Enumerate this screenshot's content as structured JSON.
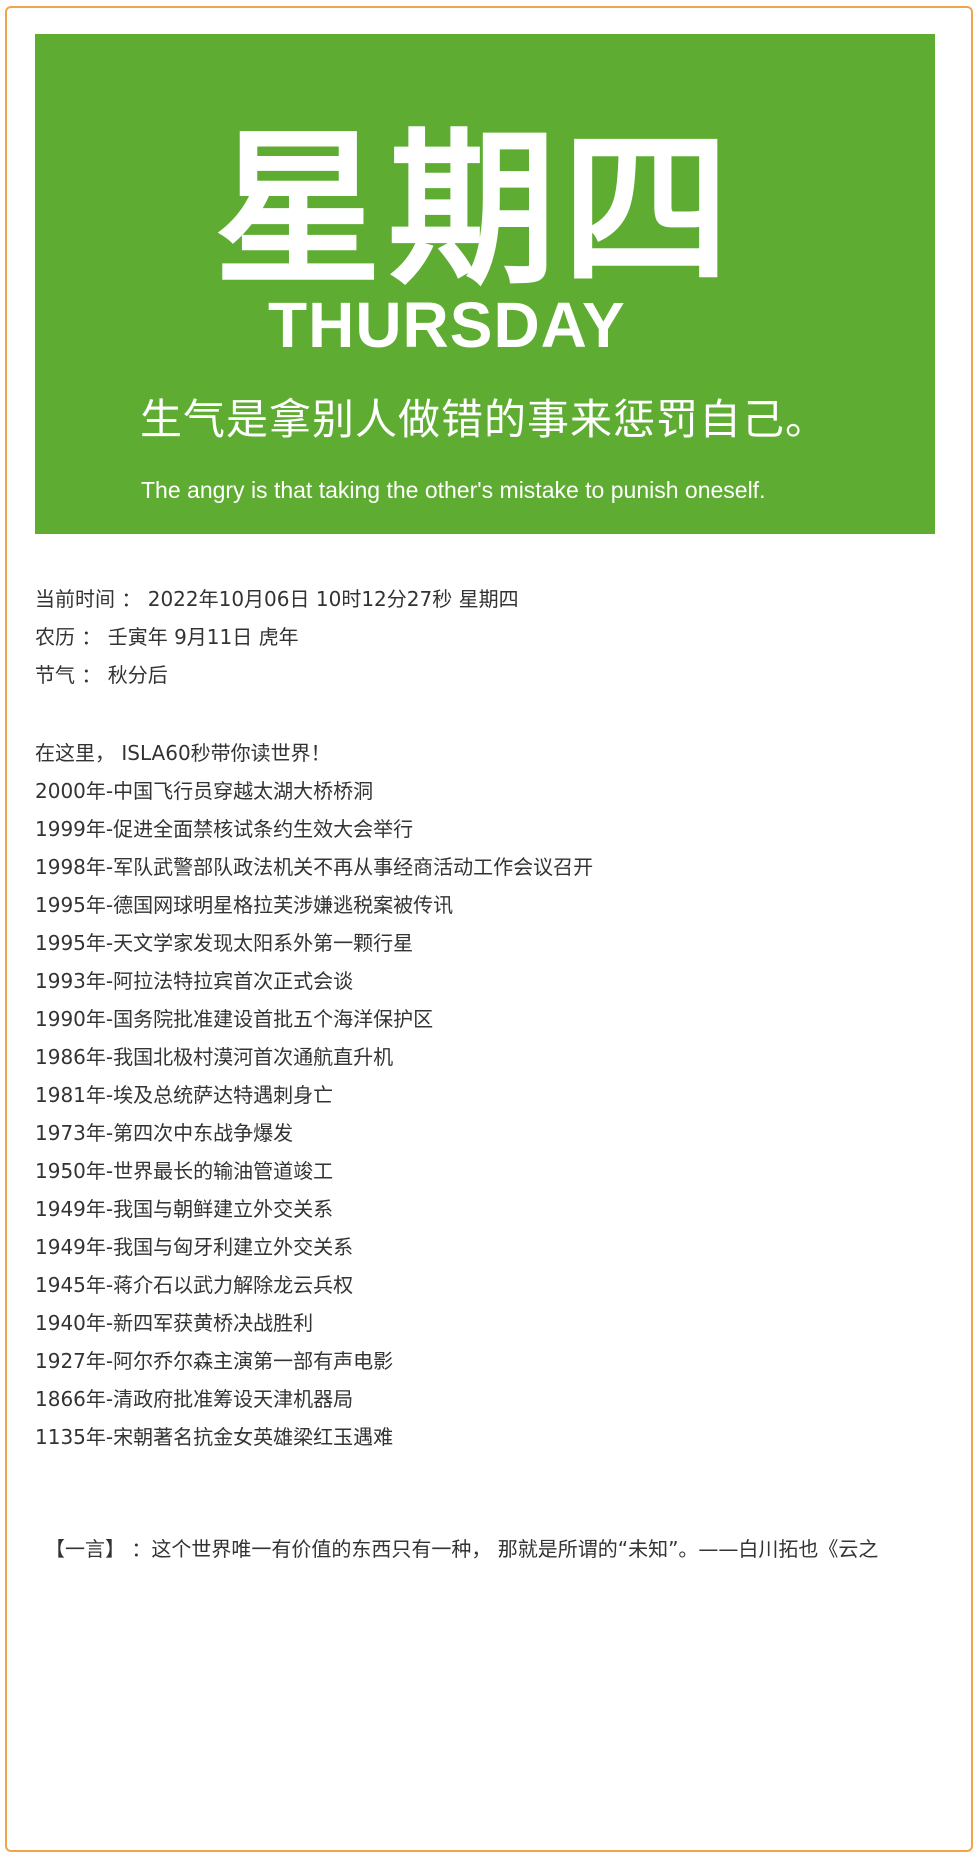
{
  "banner": {
    "weekday_cn": "星期四",
    "weekday_en": "THURSDAY",
    "quote_cn": "生气是拿别人做错的事来惩罚自己。",
    "quote_en": "The angry is that taking the other's mistake to punish oneself.",
    "bg_color": "#5ead32"
  },
  "info": {
    "current_time": "当前时间 ： 2022年10月06日 10时12分27秒 星期四",
    "lunar": "农历 ： 壬寅年 9月11日 虎年",
    "solar_term": "节气 ： 秋分后"
  },
  "history": {
    "intro": "在这里， ISLA60秒带你读世界！",
    "items": [
      "2000年-中国飞行员穿越太湖大桥桥洞",
      "1999年-促进全面禁核试条约生效大会举行",
      "1998年-军队武警部队政法机关不再从事经商活动工作会议召开",
      "1995年-德国网球明星格拉芙涉嫌逃税案被传讯",
      "1995年-天文学家发现太阳系外第一颗行星",
      "1993年-阿拉法特拉宾首次正式会谈",
      "1990年-国务院批准建设首批五个海洋保护区",
      "1986年-我国北极村漠河首次通航直升机",
      "1981年-埃及总统萨达特遇刺身亡",
      "1973年-第四次中东战争爆发",
      "1950年-世界最长的输油管道竣工",
      "1949年-我国与朝鲜建立外交关系",
      "1949年-我国与匈牙利建立外交关系",
      "1945年-蒋介石以武力解除龙云兵权",
      "1940年-新四军获黄桥决战胜利",
      "1927年-阿尔乔尔森主演第一部有声电影",
      "1866年-清政府批准筹设天津机器局",
      "1135年-宋朝著名抗金女英雄梁红玉遇难"
    ]
  },
  "yiyan": {
    "text": "【一言】 ：这个世界唯一有价值的东西只有一种， 那就是所谓的“未知”。——白川拓也《云之"
  },
  "frame_color": "#f0a54c"
}
